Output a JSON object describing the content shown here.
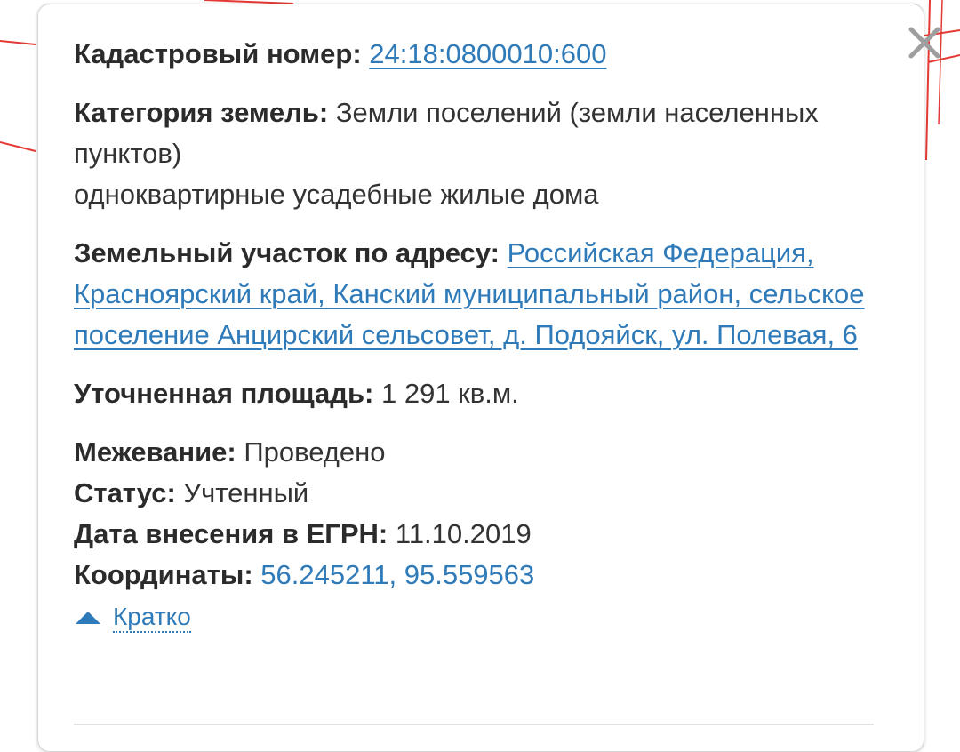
{
  "popup": {
    "cadastral": {
      "label": "Кадастровый номер:",
      "value": "24:18:0800010:600"
    },
    "land_category": {
      "label": "Категория земель:",
      "value": "Земли поселений (земли населенных пунктов)",
      "usage": "одноквартирные усадебные жилые дома"
    },
    "address": {
      "label": "Земельный участок по адресу:",
      "value": "Российская Федерация, Красноярский край, Канский муниципальный район, сельское поселение Анцирский сельсовет, д. Подояйск, ул. Полевая, 6"
    },
    "area": {
      "label": "Уточненная площадь:",
      "value": "1 291 кв.м."
    },
    "survey": {
      "label": "Межевание:",
      "value": "Проведено"
    },
    "status": {
      "label": "Статус:",
      "value": "Учтенный"
    },
    "egrn_date": {
      "label": "Дата внесения в ЕГРН:",
      "value": "11.10.2019"
    },
    "coordinates": {
      "label": "Координаты:",
      "value": "56.245211, 95.559563"
    },
    "collapse_label": "Кратко"
  },
  "colors": {
    "link": "#2f7ab8",
    "map_parcel_line": "#e53935",
    "text": "#333333"
  }
}
